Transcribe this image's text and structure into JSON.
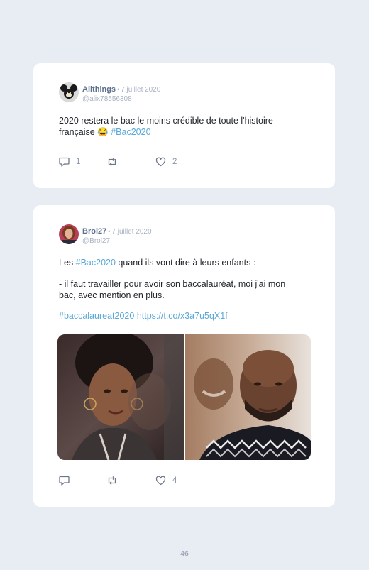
{
  "posts": [
    {
      "author": "Allthings",
      "separator": "•",
      "date": "7 juillet 2020",
      "handle": "@alix78556308",
      "text_line1": "2020 restera le bac le moins crédible de toute l'histoire",
      "text_line2_prefix": "française 😂 ",
      "hashtag": "#Bac2020",
      "reply_count": "1",
      "like_count": "2",
      "avatar_icon": "mickey-avatar"
    },
    {
      "author": "Brol27",
      "separator": "•",
      "date": "7 juillet 2020",
      "handle": "@Brol27",
      "line1_prefix": "Les ",
      "line1_hashtag": "#Bac2020",
      "line1_suffix": " quand ils vont dire à leurs enfants :",
      "quote_line1": "- il faut travailler pour avoir son baccalauréat, moi j'ai mon",
      "quote_line2": "bac, avec mention en plus.",
      "footer_hashtag": "#baccalaureat2020",
      "footer_link": "https://t.co/x3a7u5qX1f",
      "like_count": "4",
      "avatar_icon": "woman-avatar"
    }
  ],
  "page_number": "46",
  "colors": {
    "background": "#e8ecf3",
    "card": "#ffffff",
    "hashtag": "#5aa8d8",
    "muted": "#a9b3c2",
    "author": "#5b6f8a"
  }
}
